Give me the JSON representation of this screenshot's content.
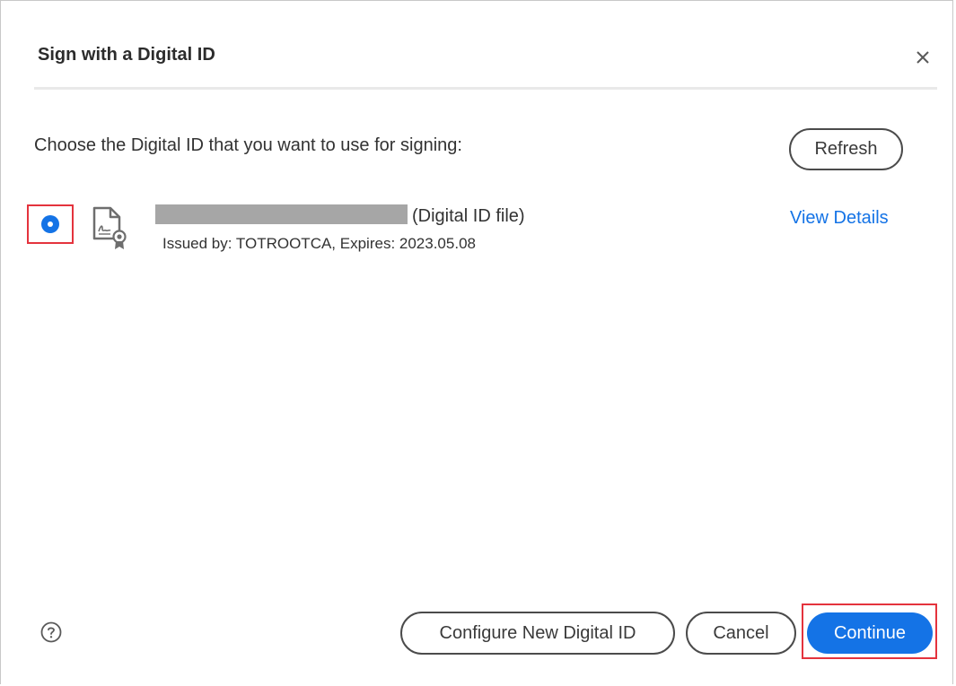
{
  "dialog": {
    "title": "Sign with a Digital ID",
    "prompt": "Choose the Digital ID that you want to use for signing:",
    "refresh_label": "Refresh"
  },
  "digital_id": {
    "type_label": "(Digital ID file)",
    "issued_line": "Issued by: TOTROOTCA, Expires: 2023.05.08",
    "view_details_label": "View Details",
    "selected": true,
    "icon": "certificate-file-icon"
  },
  "footer": {
    "configure_label": "Configure New Digital ID",
    "cancel_label": "Cancel",
    "continue_label": "Continue",
    "help_icon": "help-icon"
  },
  "colors": {
    "accent": "#1473e6",
    "highlight": "#e4333d",
    "redaction": "#a6a6a6"
  }
}
